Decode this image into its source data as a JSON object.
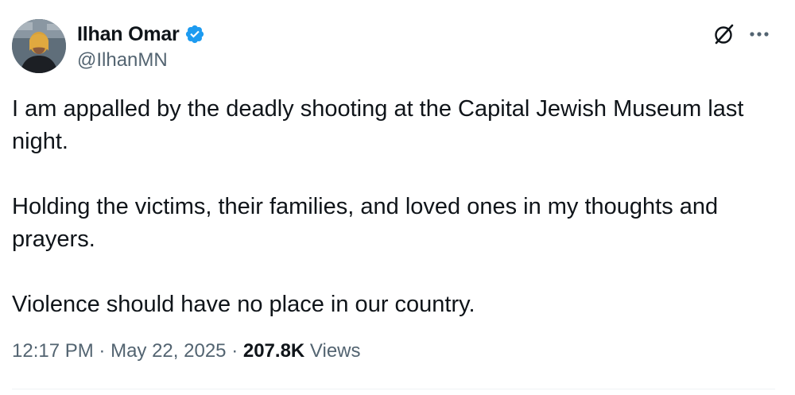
{
  "author": {
    "display_name": "Ilhan Omar",
    "handle": "@IlhanMN",
    "verified_icon": "verified-badge-icon",
    "verified_color": "#1d9bf0"
  },
  "tweet": {
    "paragraphs": [
      "I am appalled by the deadly shooting at the Capital Jewish Museum last night.",
      "Holding the victims, their families, and loved ones in my thoughts and prayers.",
      "Violence should have no place in our country."
    ],
    "time": "12:17 PM",
    "separator": "·",
    "date": "May 22, 2025",
    "views_count": "207.8K",
    "views_label": "Views"
  },
  "colors": {
    "text": "#0f1419",
    "secondary": "#536471",
    "divider": "#eff3f4"
  },
  "icons": {
    "grok": "grok-icon",
    "more": "more-options-icon"
  }
}
